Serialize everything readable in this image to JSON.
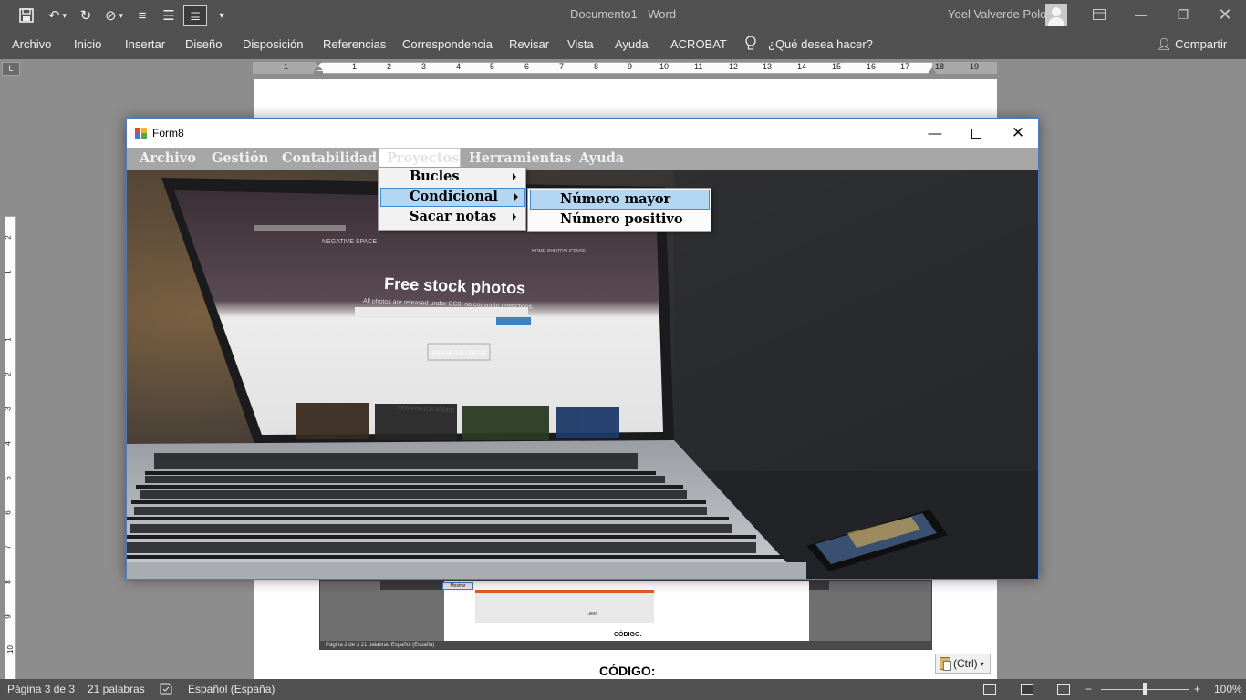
{
  "word": {
    "window_title": "Documento1  -  Word",
    "user_name": "Yoel Valverde Polo",
    "ribbon_tabs": [
      "Archivo",
      "Inicio",
      "Insertar",
      "Diseño",
      "Disposición",
      "Referencias",
      "Correspondencia",
      "Revisar",
      "Vista",
      "Ayuda",
      "ACROBAT"
    ],
    "tell_me": "¿Qué desea hacer?",
    "share": "Compartir",
    "tab_selector": "L",
    "hruler_numbers": [
      "1",
      "1",
      "2",
      "3",
      "4",
      "5",
      "6",
      "7",
      "8",
      "9",
      "10",
      "11",
      "12",
      "13",
      "14",
      "15",
      "16",
      "17",
      "18",
      "19"
    ],
    "vruler_numbers": [
      "2",
      "1",
      "1",
      "2",
      "3",
      "4",
      "5",
      "6",
      "7",
      "8",
      "9",
      "10"
    ],
    "status": {
      "page": "Página 3 de 3",
      "words": "21 palabras",
      "language": "Español (España)",
      "zoom": "100%"
    },
    "document": {
      "heading": "CÓDIGO:",
      "paste_options": "(Ctrl)",
      "nested_screenshot": {
        "button": "Mostrar",
        "heading": "CÓDIGO:",
        "status": "Página 2 de 3     21 palabras     Español (España)",
        "caption": "Likes"
      }
    }
  },
  "form": {
    "title": "Form8",
    "menu": [
      "Archivo",
      "Gestión",
      "Contabilidad",
      "Proyectos",
      "Herramientas",
      "Ayuda"
    ],
    "open_menu": "Proyectos",
    "proyectos_items": [
      {
        "label": "Bucles",
        "submenu": true
      },
      {
        "label": "Condicional",
        "submenu": true,
        "highlighted": true
      },
      {
        "label": "Sacar notas",
        "submenu": true
      }
    ],
    "condicional_items": [
      {
        "label": "Número mayor",
        "highlighted": true
      },
      {
        "label": "Número positivo"
      }
    ],
    "image": {
      "site_name": "NEGATIVE SPACE",
      "nav": [
        "HOME",
        "PHOTOS",
        "LICENSE"
      ],
      "headline": "Free stock photos",
      "subline": "All photos are released under CC0, no copyright restrictions.",
      "cta": "BROWSE OUR CONTENT",
      "section": "NEW PHOTOS ADDED"
    }
  },
  "colors": {
    "word_chrome": "#515151",
    "app_background": "#8d8d8d",
    "form_menubar": "#a6a6a6",
    "menu_highlight": "#b3d7f3",
    "menu_highlight_border": "#3f8ad4"
  }
}
